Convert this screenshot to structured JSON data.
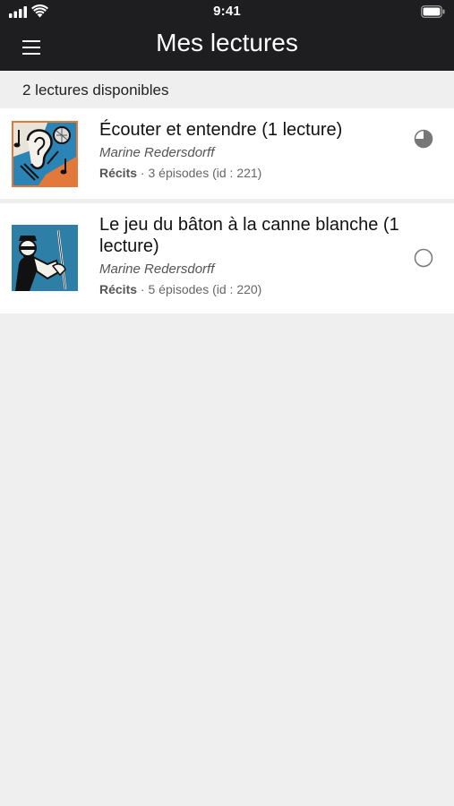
{
  "status_bar": {
    "time": "9:41"
  },
  "header": {
    "title": "Mes lectures"
  },
  "count_label": "2 lectures disponibles",
  "items": [
    {
      "title": "Écouter et entendre (1 lecture)",
      "author": "Marine Redersdorff",
      "category": "Récits",
      "separator": "·",
      "episodes": "3 épisodes (id : 221)",
      "progress": 0.25,
      "thumb_icon": "ear-music-illustration-icon"
    },
    {
      "title": "Le jeu du bâton à la canne blanche (1 lecture)",
      "author": "Marine Redersdorff",
      "category": "Récits",
      "separator": "·",
      "episodes": "5 épisodes (id : 220)",
      "progress": 0,
      "thumb_icon": "man-with-white-cane-illustration-icon"
    }
  ]
}
